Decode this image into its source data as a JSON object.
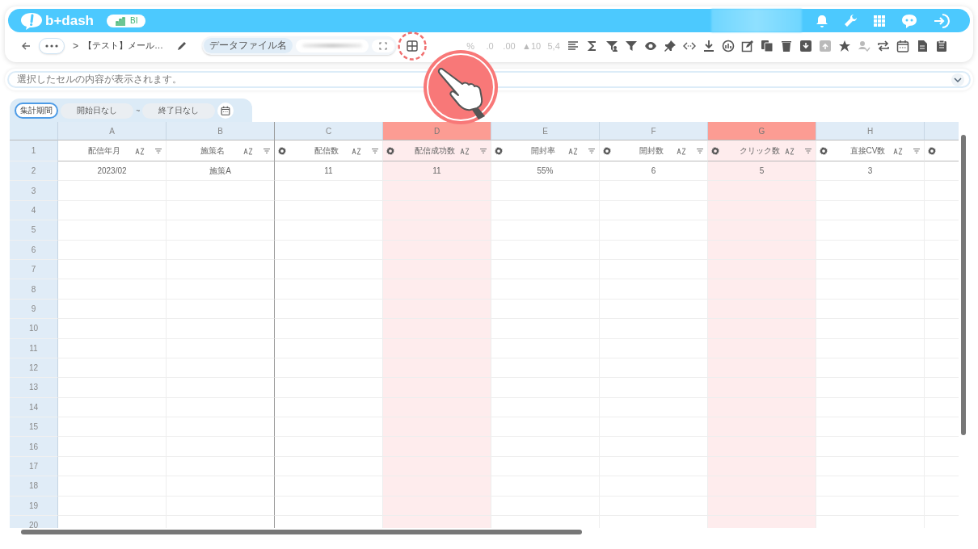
{
  "header": {
    "logo": "b+dash",
    "badge": "BI"
  },
  "toolbar": {
    "back": true,
    "separator": ">",
    "breadcrumb": "【テスト】メール…",
    "file_label": "データファイル名",
    "tools": [
      {
        "kind": "grid",
        "disabled": false,
        "highlighted": true
      },
      {
        "kind": "text",
        "label": "%",
        "disabled": true,
        "highlighted": false
      },
      {
        "kind": "text",
        "label": ".0",
        "disabled": true,
        "highlighted": false
      },
      {
        "kind": "text",
        "label": ".00",
        "disabled": true,
        "highlighted": false
      },
      {
        "kind": "text",
        "label": "▲10",
        "disabled": true,
        "highlighted": false
      },
      {
        "kind": "text",
        "label": "5,4",
        "disabled": true,
        "highlighted": false
      },
      {
        "kind": "align",
        "disabled": false,
        "highlighted": false
      },
      {
        "kind": "sigma",
        "disabled": false,
        "highlighted": false
      },
      {
        "kind": "funnel-person",
        "disabled": false,
        "highlighted": false
      },
      {
        "kind": "funnel",
        "disabled": false,
        "highlighted": false
      },
      {
        "kind": "eye",
        "disabled": false,
        "highlighted": false
      },
      {
        "kind": "pin",
        "disabled": false,
        "highlighted": false
      },
      {
        "kind": "code",
        "disabled": false,
        "highlighted": false
      },
      {
        "kind": "download",
        "disabled": false,
        "highlighted": false
      },
      {
        "kind": "chart",
        "disabled": false,
        "highlighted": false
      },
      {
        "kind": "edit",
        "disabled": false,
        "highlighted": false
      },
      {
        "kind": "copy",
        "disabled": false,
        "highlighted": false
      },
      {
        "kind": "trash",
        "disabled": false,
        "highlighted": false
      },
      {
        "kind": "archive-down",
        "disabled": false,
        "highlighted": false
      },
      {
        "kind": "archive-up",
        "disabled": true,
        "highlighted": false
      },
      {
        "kind": "star",
        "disabled": false,
        "highlighted": false
      },
      {
        "kind": "person-check",
        "disabled": true,
        "highlighted": false
      },
      {
        "kind": "repeat",
        "disabled": false,
        "highlighted": false
      },
      {
        "kind": "calendar",
        "disabled": false,
        "highlighted": false
      },
      {
        "kind": "document",
        "disabled": false,
        "highlighted": false
      },
      {
        "kind": "clipboard",
        "disabled": false,
        "highlighted": false
      }
    ]
  },
  "formula_bar": {
    "placeholder": "選択したセルの内容が表示されます。"
  },
  "period": {
    "label": "集計期間",
    "start": "開始日なし",
    "separator": "~",
    "end": "終了日なし"
  },
  "grid": {
    "header_row": "1",
    "columns": [
      {
        "letter": "A",
        "title": "配信年月",
        "selected": false,
        "gear": false
      },
      {
        "letter": "B",
        "title": "施策名",
        "selected": false,
        "gear": false
      },
      {
        "letter": "C",
        "title": "配信数",
        "selected": false,
        "gear": true
      },
      {
        "letter": "D",
        "title": "配信成功数",
        "selected": true,
        "gear": true
      },
      {
        "letter": "E",
        "title": "開封率",
        "selected": false,
        "gear": true
      },
      {
        "letter": "F",
        "title": "開封数",
        "selected": false,
        "gear": true
      },
      {
        "letter": "G",
        "title": "クリック数",
        "selected": true,
        "gear": true
      },
      {
        "letter": "H",
        "title": "直接CV数",
        "selected": false,
        "gear": true
      },
      {
        "selected": false,
        "gear": true
      }
    ],
    "rows": [
      {
        "number": "2",
        "cells": [
          "2023/02",
          "施策A",
          "11",
          "11",
          "55%",
          "6",
          "5",
          "3"
        ]
      },
      {
        "number": "3"
      },
      {
        "number": "4"
      },
      {
        "number": "5"
      },
      {
        "number": "6"
      },
      {
        "number": "7"
      },
      {
        "number": "8"
      },
      {
        "number": "9"
      },
      {
        "number": "10"
      },
      {
        "number": "11"
      },
      {
        "number": "12"
      },
      {
        "number": "13"
      },
      {
        "number": "14"
      },
      {
        "number": "15"
      },
      {
        "number": "16"
      },
      {
        "number": "17"
      },
      {
        "number": "18"
      },
      {
        "number": "19"
      },
      {
        "number": "20"
      }
    ]
  }
}
